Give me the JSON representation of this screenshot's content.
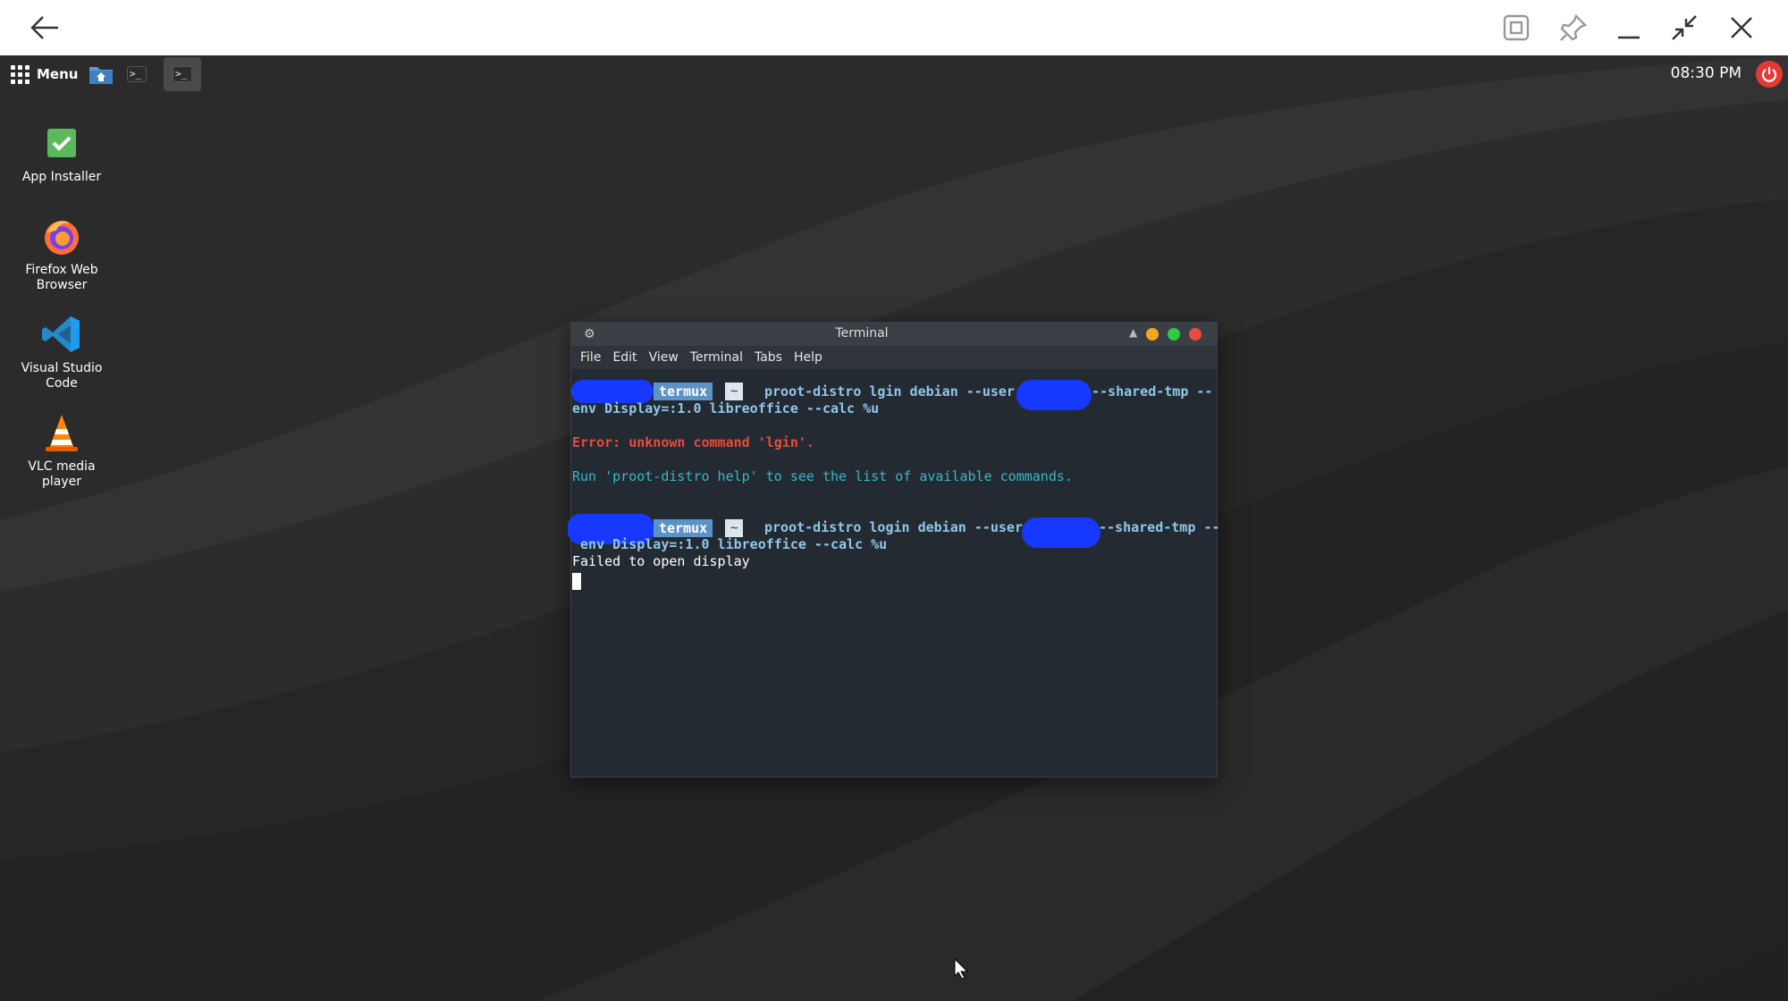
{
  "desktop": {
    "panel": {
      "menu_label": "Menu",
      "clock": "08:30 PM"
    },
    "icons": [
      {
        "label": "App Installer"
      },
      {
        "label": "Firefox Web\nBrowser"
      },
      {
        "label": "Visual Studio\nCode"
      },
      {
        "label": "VLC media\nplayer"
      }
    ]
  },
  "terminal": {
    "title": "Terminal",
    "menu": [
      "File",
      "Edit",
      "View",
      "Terminal",
      "Tabs",
      "Help"
    ],
    "prompt_host": "termux",
    "prompt_dir": "~",
    "line1_cmd": "proot-distro lgin debian --user",
    "line1_tail": "--shared-tmp --",
    "line2": "env Display=:1.0 libreoffice --calc %u",
    "error_line": "Error: unknown command 'lgin'.",
    "hint_line": "Run 'proot-distro help' to see the list of available commands.",
    "line3_cmd": "proot-distro login debian --user",
    "line3_tail": "--shared-tmp --",
    "line4": " env Display=:1.0 libreoffice --calc %u",
    "output": "Failed to open display"
  },
  "colors": {
    "accent_red": "#e53935",
    "prompt_blue": "#5d92c7",
    "error": "#e74c3c",
    "hint": "#39b7c4",
    "redaction": "#1739ff"
  }
}
